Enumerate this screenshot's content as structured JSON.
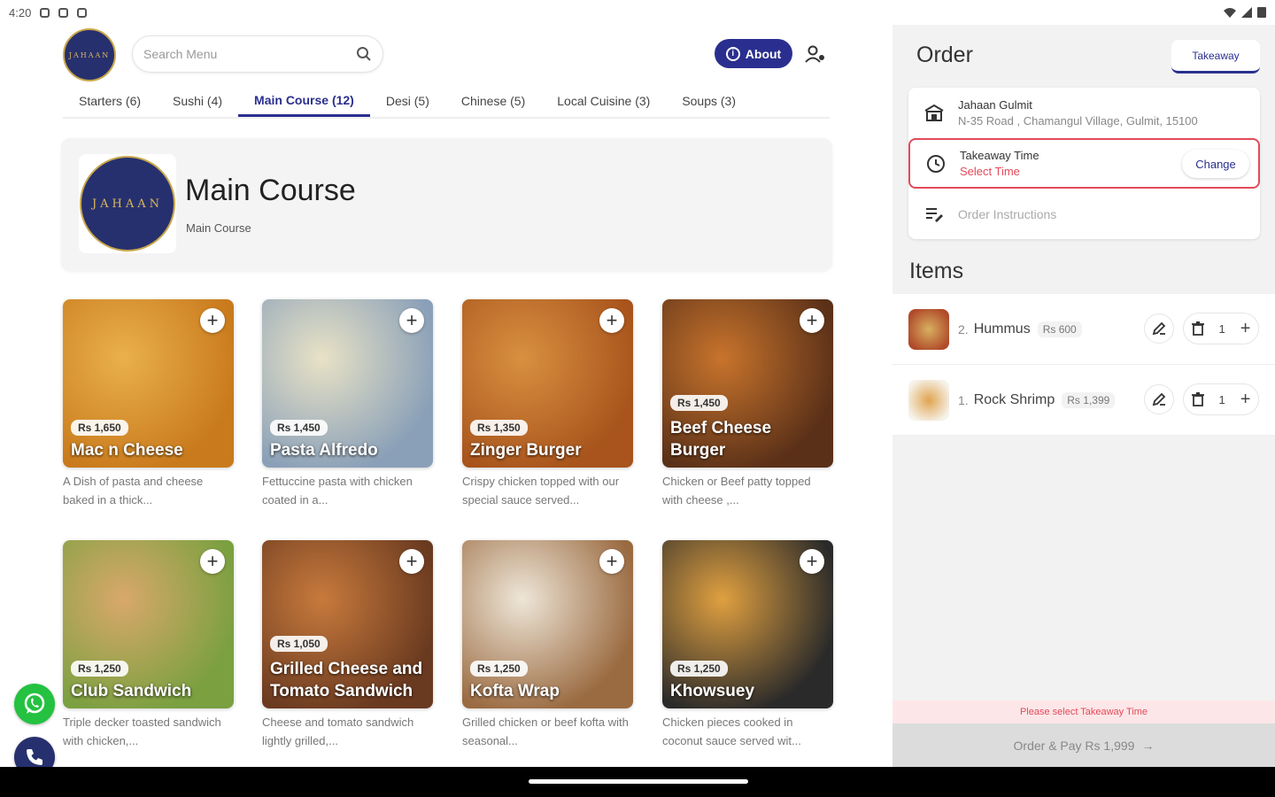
{
  "status_bar": {
    "time": "4:20"
  },
  "header": {
    "logo_text": "JAHAAN",
    "search_placeholder": "Search Menu",
    "about_label": "About"
  },
  "tabs": [
    {
      "label": "Starters (6)"
    },
    {
      "label": "Sushi (4)"
    },
    {
      "label": "Main Course (12)",
      "active": true
    },
    {
      "label": "Desi (5)"
    },
    {
      "label": "Chinese (5)"
    },
    {
      "label": "Local Cuisine (3)"
    },
    {
      "label": "Soups (3)"
    }
  ],
  "banner": {
    "title": "Main Course",
    "subtitle": "Main Course",
    "logo_text": "JAHAAN"
  },
  "menu_items": [
    {
      "name": "Mac n Cheese",
      "price": "Rs 1,650",
      "desc": "A Dish of pasta and cheese baked in a thick...",
      "colors": [
        "#e9b04a",
        "#c97a1c"
      ]
    },
    {
      "name": "Pasta Alfredo",
      "price": "Rs 1,450",
      "desc": "Fettuccine pasta with chicken coated in a...",
      "colors": [
        "#e8e2c6",
        "#8aa0b8"
      ]
    },
    {
      "name": "Zinger Burger",
      "price": "Rs 1,350",
      "desc": "Crispy chicken topped with our special sauce served...",
      "colors": [
        "#d89040",
        "#a8541c"
      ]
    },
    {
      "name": "Beef Cheese Burger",
      "price": "Rs 1,450",
      "desc": "Chicken or Beef patty topped with cheese ,...",
      "colors": [
        "#c8742c",
        "#5a3018"
      ]
    },
    {
      "name": "Club Sandwich",
      "price": "Rs 1,250",
      "desc": "Triple decker toasted sandwich with chicken,...",
      "colors": [
        "#d9a86a",
        "#7aa040"
      ]
    },
    {
      "name": "Grilled Cheese and Tomato Sandwich",
      "price": "Rs 1,050",
      "desc": "Cheese and tomato sandwich lightly grilled,...",
      "colors": [
        "#c87a3c",
        "#6a3a20"
      ]
    },
    {
      "name": "Kofta Wrap",
      "price": "Rs 1,250",
      "desc": "Grilled chicken or beef kofta with seasonal...",
      "colors": [
        "#eee6d8",
        "#9a6a40"
      ]
    },
    {
      "name": "Khowsuey",
      "price": "Rs 1,250",
      "desc": "Chicken pieces cooked in coconut sauce served wit...",
      "colors": [
        "#e0a040",
        "#2a2a2a"
      ]
    }
  ],
  "order": {
    "title": "Order",
    "mode": "Takeaway",
    "location_name": "Jahaan Gulmit",
    "location_address": "N-35 Road , Chamangul Village, Gulmit, 15100",
    "time_label": "Takeaway Time",
    "time_value": "Select Time",
    "change_label": "Change",
    "instructions_placeholder": "Order Instructions",
    "items_title": "Items",
    "items": [
      {
        "qty_prefix": "2.",
        "name": "Hummus",
        "price": "Rs 600",
        "qty": "1",
        "colors": [
          "#d8b060",
          "#b04a2a"
        ]
      },
      {
        "qty_prefix": "1.",
        "name": "Rock Shrimp",
        "price": "Rs 1,399",
        "qty": "1",
        "colors": [
          "#e0a450",
          "#f6f2ea"
        ]
      }
    ],
    "warning": "Please select Takeaway Time",
    "pay_label": "Order & Pay Rs 1,999"
  },
  "theme": {
    "primary": "#2a2f8f",
    "error": "#e34a5a",
    "whatsapp": "#25c140"
  }
}
